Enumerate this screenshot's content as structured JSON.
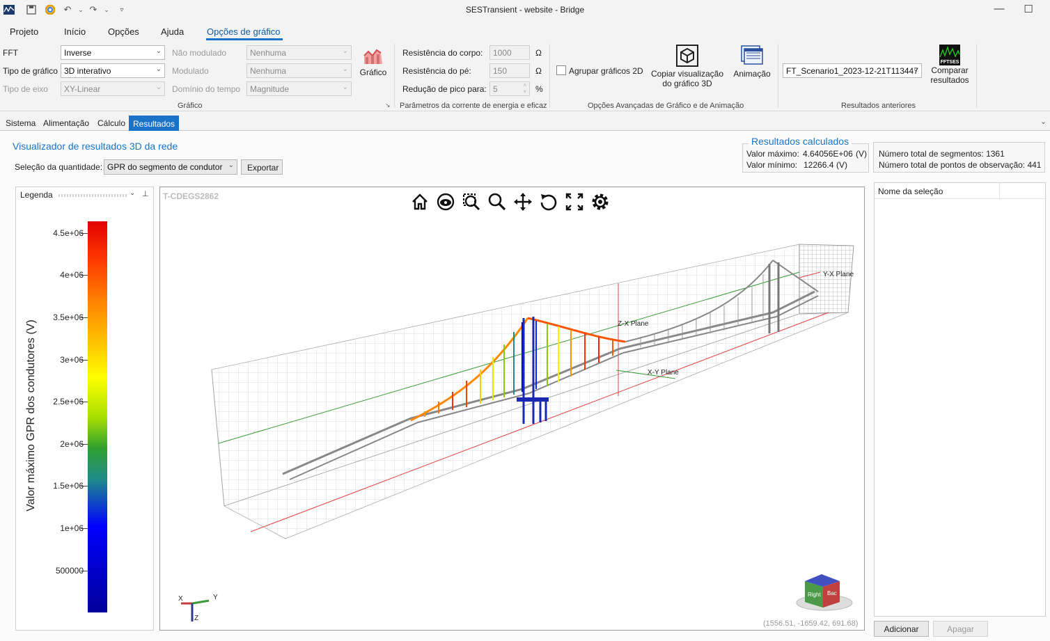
{
  "window": {
    "title": "SESTransient - website - Bridge",
    "quick_access": [
      "save-icon",
      "color-icon",
      "undo-icon",
      "redo-icon",
      "customize-icon"
    ]
  },
  "menu": [
    "Projeto",
    "Início",
    "Opções",
    "Ajuda",
    "Opções de gráfico"
  ],
  "ribbon": {
    "grafico": {
      "fft_label": "FFT",
      "fft_value": "Inverse",
      "tipo_grafico_label": "Tipo de gráfico",
      "tipo_grafico_value": "3D interativo",
      "tipo_eixo_label": "Tipo de eixo",
      "tipo_eixo_value": "XY-Linear",
      "nao_modulado_label": "Não modulado",
      "nao_modulado_value": "Nenhuma",
      "modulado_label": "Modulado",
      "modulado_value": "Nenhuma",
      "dominio_label": "Domínio do tempo",
      "dominio_value": "Magnitude",
      "grafico_button": "Gráfico",
      "group_label": "Gráfico"
    },
    "parametros": {
      "corpo_label": "Resistência do corpo:",
      "corpo_value": "1000",
      "corpo_unit": "Ω",
      "pe_label": "Resistência do pé:",
      "pe_value": "150",
      "pe_unit": "Ω",
      "pico_label": "Redução de pico para:",
      "pico_value": "5",
      "pico_unit": "%",
      "group_label": "Parâmetros da corrente de energia e eficaz"
    },
    "avancadas": {
      "agrupar_label": "Agrupar gráficos 2D",
      "copiar_label_1": "Copiar visualização",
      "copiar_label_2": "do gráfico 3D",
      "animacao_label": "Animação",
      "group_label": "Opções Avançadas de Gráfico e de Animação"
    },
    "anteriores": {
      "scenario_value": "FT_Scenario1_2023-12-21T113447",
      "comparar_label_1": "Comparar",
      "comparar_label_2": "resultados",
      "fftses_label": "FFTSES",
      "group_label": "Resultados anteriores"
    }
  },
  "tabs": [
    "Sistema",
    "Alimentação",
    "Cálculo",
    "Resultados"
  ],
  "viewer": {
    "title": "Visualizador de resultados 3D da rede",
    "quantity_label": "Seleção da quantidade:",
    "quantity_value": "GPR do segmento de condutor",
    "export_button": "Exportar",
    "calc_title": "Resultados calculados",
    "max_label": "Valor máximo:",
    "max_value": "4.64056E+06",
    "max_unit": "(V)",
    "min_label": "Valor mínimo:",
    "min_value": "12266.4",
    "min_unit": "(V)",
    "segments_text": "Número total de segmentos: 1361",
    "points_text": "Número total de pontos de observação: 441"
  },
  "legend": {
    "title": "Legenda",
    "axis_label": "Valor máximo GPR dos condutores  (V)",
    "ticks": [
      "4.5e+06",
      "4e+06",
      "3.5e+06",
      "3e+06",
      "2.5e+06",
      "2e+06",
      "1.5e+06",
      "1e+06",
      "500000"
    ]
  },
  "plot": {
    "watermark": "T-CDEGS2862",
    "plane_yx": "Y-X Plane",
    "plane_zx": "Z-X Plane",
    "plane_xy": "X-Y Plane",
    "coords": "(1556.51, -1659.42, 691.68)",
    "axis_x": "X",
    "axis_y": "Y",
    "axis_z": "Z",
    "cube_right": "Right",
    "cube_back": "Bac",
    "toolbar": [
      "home-icon",
      "eye-icon",
      "zoom-box-icon",
      "zoom-icon",
      "pan-icon",
      "rotate-icon",
      "fullscreen-icon",
      "settings-icon"
    ]
  },
  "selection": {
    "column_header": "Nome da seleção",
    "add_button": "Adicionar",
    "delete_button": "Apagar"
  }
}
